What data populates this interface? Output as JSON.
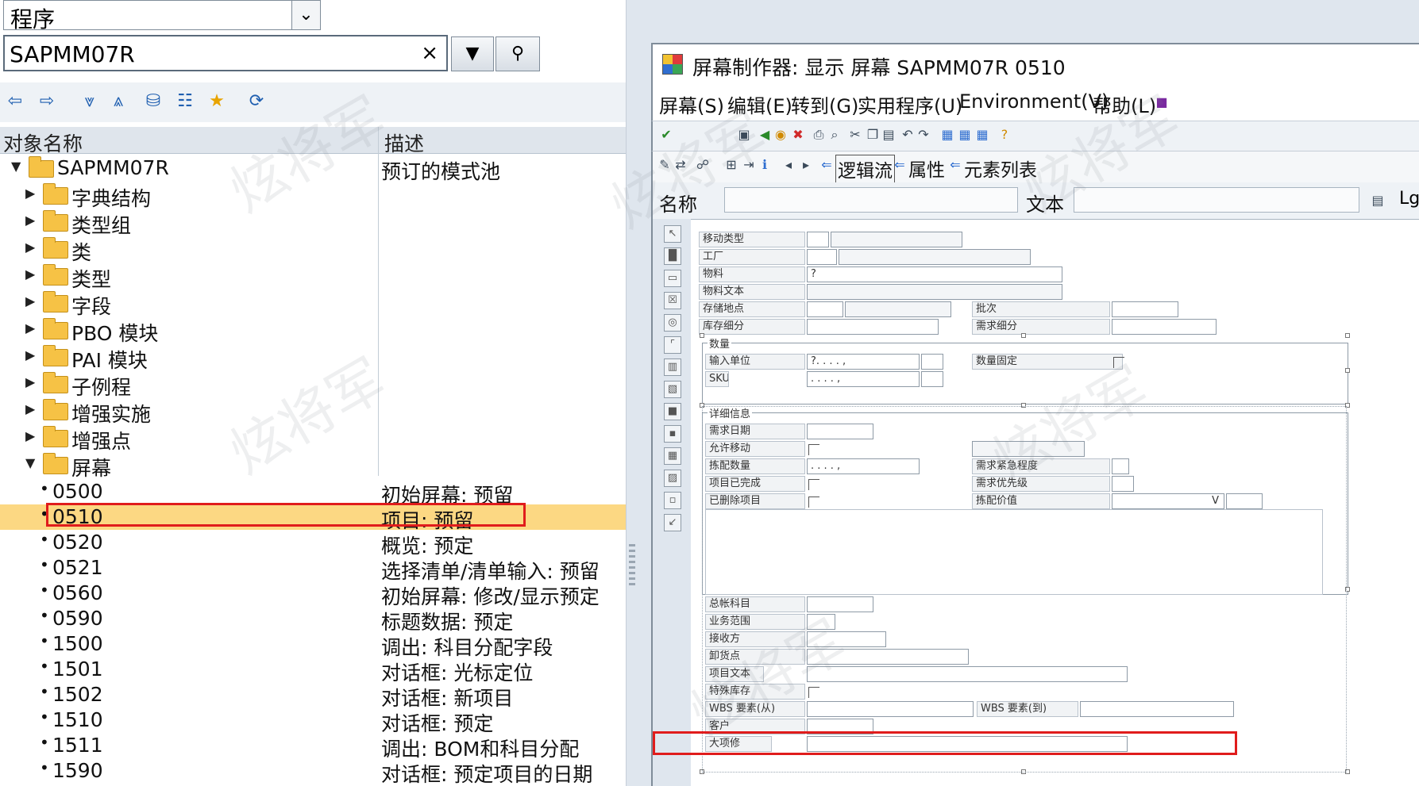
{
  "left": {
    "object_type": "程序",
    "program_name": "SAPMM07R",
    "clear_glyph": "×",
    "col_object": "对象名称",
    "col_desc": "描述",
    "root": {
      "label": "SAPMM07R",
      "desc": "预订的模式池"
    },
    "folders": [
      {
        "label": "字典结构"
      },
      {
        "label": "类型组"
      },
      {
        "label": "类"
      },
      {
        "label": "类型"
      },
      {
        "label": "字段"
      },
      {
        "label": "PBO 模块"
      },
      {
        "label": "PAI 模块"
      },
      {
        "label": "子例程"
      },
      {
        "label": "增强实施"
      },
      {
        "label": "增强点"
      },
      {
        "label": "屏幕"
      }
    ],
    "screens": [
      {
        "no": "0500",
        "desc": "初始屏幕: 预留"
      },
      {
        "no": "0510",
        "desc": "项目: 预留"
      },
      {
        "no": "0520",
        "desc": "概览: 预定"
      },
      {
        "no": "0521",
        "desc": "选择清单/清单输入: 预留"
      },
      {
        "no": "0560",
        "desc": "初始屏幕: 修改/显示预定"
      },
      {
        "no": "0590",
        "desc": "标题数据: 预定"
      },
      {
        "no": "1500",
        "desc": "调出: 科目分配字段"
      },
      {
        "no": "1501",
        "desc": "对话框: 光标定位"
      },
      {
        "no": "1502",
        "desc": "对话框: 新项目"
      },
      {
        "no": "1510",
        "desc": "对话框: 预定"
      },
      {
        "no": "1511",
        "desc": "调出: BOM和科目分配"
      },
      {
        "no": "1590",
        "desc": "对话框: 预定项目的日期"
      }
    ]
  },
  "right": {
    "title": "屏幕制作器: 显示 屏幕 SAPMM07R 0510",
    "menus": [
      "屏幕(S)",
      "编辑(E)",
      "转到(G)",
      "实用程序(U)",
      "Environment(V)",
      "帮助(L)"
    ],
    "nav": {
      "logic": "逻辑流",
      "attrs": "属性",
      "elements": "元素列表"
    },
    "name_label": "名称",
    "text_label": "文本",
    "lg_label": "Lg",
    "painter": {
      "move_type": "移动类型",
      "plant": "工厂",
      "material": "物料",
      "material_placeholder": "?",
      "material_text": "物料文本",
      "storage_loc": "存储地点",
      "batch": "批次",
      "stock_sub": "库存细分",
      "req_sub": "需求细分",
      "qty_group": "数量",
      "entry_unit": "输入单位",
      "entry_unit_val": "?.  .  .  .  ,",
      "qty_fixed": "数量固定",
      "sku": "SKU",
      "sku_val": ".  .  .  .  ,",
      "detail_group": "详细信息",
      "req_date": "需求日期",
      "allow_move": "允许移动",
      "alloc_qty": "拣配数量",
      "alloc_qty_val": ".  .  .  .  ,",
      "urgency": "需求紧急程度",
      "item_done": "项目已完成",
      "priority": "需求优先级",
      "deleted": "已删除项目",
      "pick_value": "拣配价值",
      "pick_value_flag": "V",
      "gl_account": "总帐科目",
      "business_area": "业务范围",
      "recipient": "接收方",
      "unloading": "卸货点",
      "item_text": "项目文本",
      "special_stock": "特殊库存",
      "wbs_from": "WBS 要素(从)",
      "wbs_to": "WBS 要素(到)",
      "customer": "客户",
      "overhaul": "大项修"
    }
  },
  "watermark": "炫将军"
}
